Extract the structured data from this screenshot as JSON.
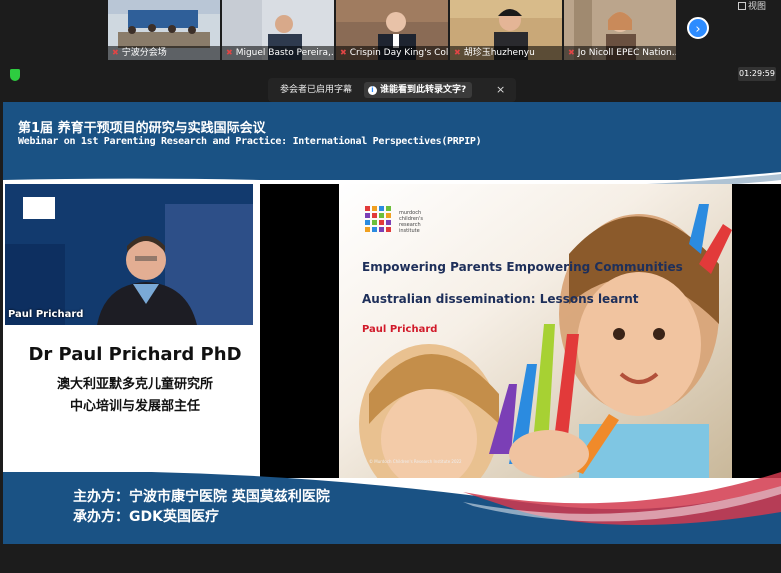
{
  "gallery": {
    "participants": [
      {
        "name": "宁波分会场"
      },
      {
        "name": "Miguel Basto Pereira,..."
      },
      {
        "name": "Crispin Day King's Coll..."
      },
      {
        "name": "胡珍玉huzhenyu"
      },
      {
        "name": "Jo Nicoll EPEC Nation..."
      }
    ],
    "next_icon": "›",
    "view_label": "视图"
  },
  "timer": "01:29:59",
  "captions": {
    "notice": "参会者已启用字幕",
    "prompt": "谁能看到此转录文字?",
    "close": "×"
  },
  "slide": {
    "title_cn": "第1届 养育干预项目的研究与实践国际会议",
    "title_en": "Webinar on 1st  Parenting Research and Practice: International Perspectives(PRPIP)",
    "speaker_video_label": "Paul Prichard",
    "speaker_name": "Dr Paul Prichard PhD",
    "speaker_org_line1": "澳大利亚默多克儿童研究所",
    "speaker_org_line2": "中心培训与发展部主任",
    "host": "主办方：宁波市康宁医院  英国莫兹利医院",
    "co_host": "承办方：GDK英国医疗"
  },
  "presentation": {
    "institute": "murdoch children's research institute",
    "heading1": "Empowering Parents Empowering Communities",
    "heading2": "Australian dissemination: Lessons learnt",
    "presenter": "Paul Prichard",
    "copyright": "© Murdoch Children's Research Institute 2022"
  }
}
